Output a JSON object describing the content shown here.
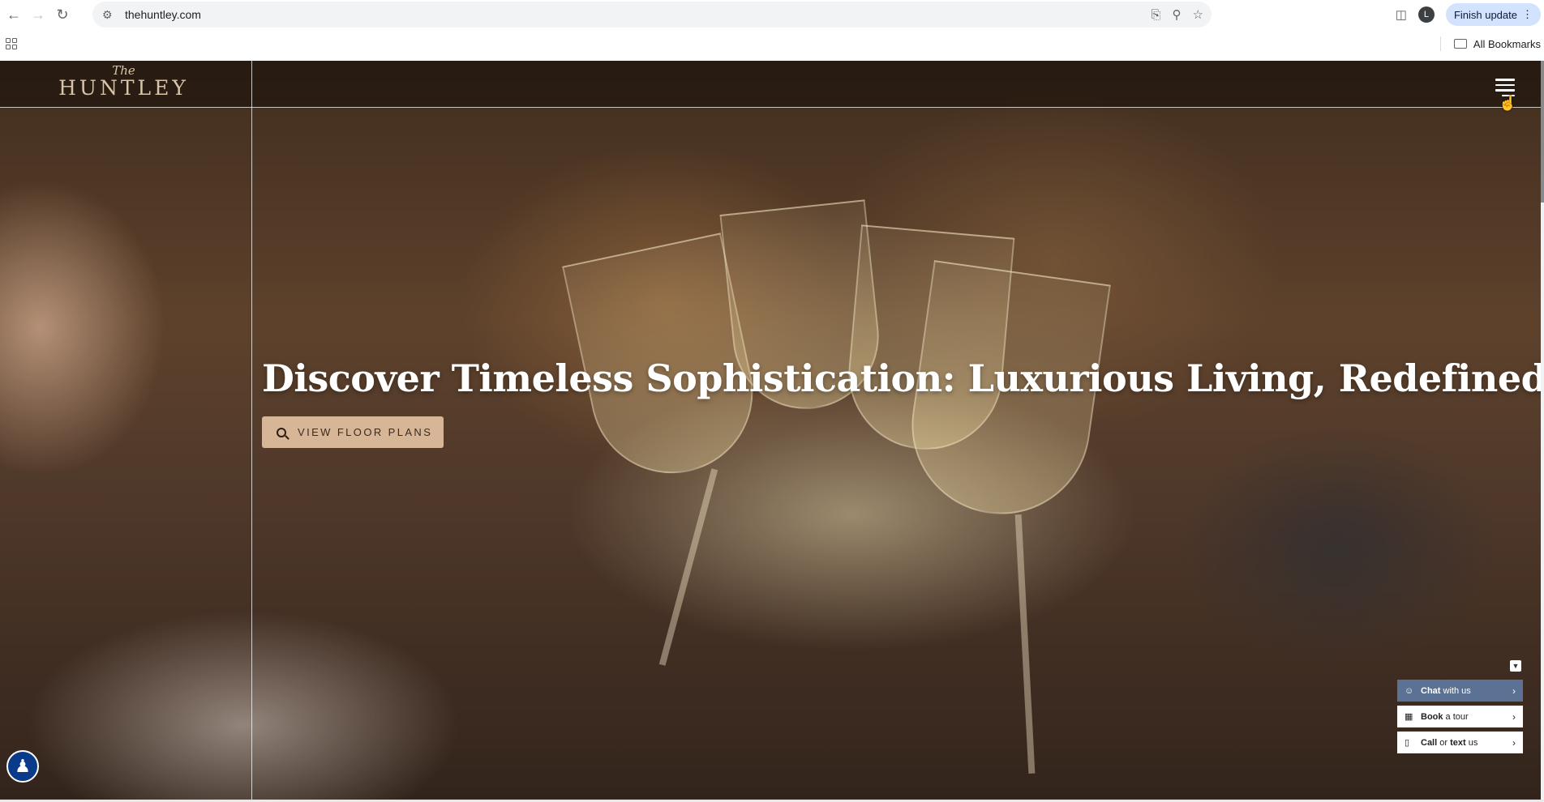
{
  "browser": {
    "url": "thehuntley.com",
    "finish_update_label": "Finish update",
    "profile_initial": "L",
    "bookmarks_label": "All Bookmarks"
  },
  "site": {
    "logo_small": "The",
    "logo_main": "HUNTLEY",
    "hero_title": "Discover Timeless Sophistication: Luxurious Living, Redefined.",
    "cta_label": "VIEW FLOOR PLANS"
  },
  "widget": {
    "chat": {
      "bold": "Chat",
      "rest": " with us"
    },
    "tour": {
      "bold": "Book",
      "rest": " a tour"
    },
    "call": {
      "bold": "Call",
      "rest": " or ",
      "bold2": "text",
      "rest2": " us"
    }
  },
  "colors": {
    "cta_bg": "#d7b697",
    "chat_bg": "#5b7294",
    "a11y_bg": "#0a3a8a",
    "logo": "#d8c4a8"
  }
}
